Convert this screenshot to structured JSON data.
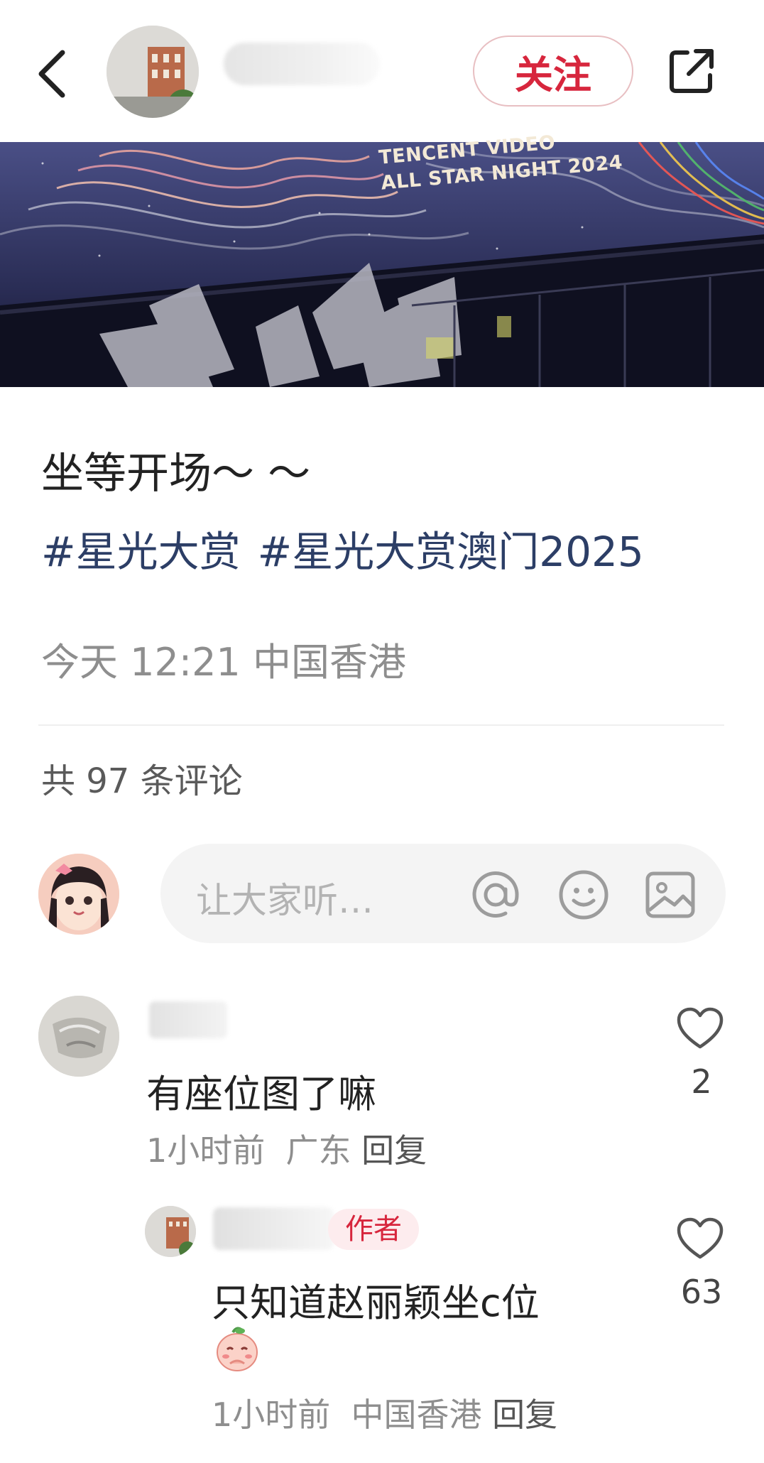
{
  "header": {
    "follow_label": "关注"
  },
  "banner": {
    "line1": "TENCENT VIDEO",
    "line2": "ALL STAR NIGHT 2024"
  },
  "post": {
    "title": "坐等开场～ ～",
    "tags": [
      "#星光大赏",
      "#星光大赏澳门2025"
    ],
    "time": "今天 12:21",
    "location": "中国香港"
  },
  "comments_summary": {
    "text": "共 97 条评论"
  },
  "comment_input": {
    "placeholder": "让大家听…"
  },
  "comments": [
    {
      "text": "有座位图了嘛",
      "time": "1小时前",
      "location": "广东",
      "reply_label": "回复",
      "likes": "2"
    }
  ],
  "replies": [
    {
      "badge": "作者",
      "text": "只知道赵丽颖坐c位",
      "time": "1小时前",
      "location": "中国香港",
      "reply_label": "回复",
      "likes": "63"
    }
  ],
  "icons": [
    "back-icon",
    "share-icon",
    "at-icon",
    "emoji-icon",
    "image-icon",
    "heart-icon"
  ],
  "colors": {
    "accent_red": "#d7263d",
    "tag_blue": "#2c3e66"
  }
}
